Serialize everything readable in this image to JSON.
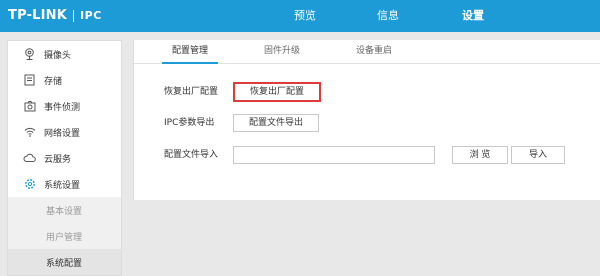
{
  "header": {
    "logo": "TP-LINK",
    "product": "IPC",
    "nav": [
      "预览",
      "信息",
      "设置"
    ],
    "active_nav": "设置",
    "color": "#1c9bd6"
  },
  "sidebar": {
    "items": [
      {
        "label": "摄像头",
        "icon": "camera-icon"
      },
      {
        "label": "存储",
        "icon": "storage-icon"
      },
      {
        "label": "事件侦测",
        "icon": "event-detect-icon"
      },
      {
        "label": "网络设置",
        "icon": "wifi-icon"
      },
      {
        "label": "云服务",
        "icon": "cloud-icon"
      },
      {
        "label": "系统设置",
        "icon": "gear-icon"
      }
    ],
    "sub_items": [
      "基本设置",
      "用户管理",
      "系统配置"
    ],
    "current_sub": "系统配置"
  },
  "tabs": [
    "配置管理",
    "固件升级",
    "设备重启"
  ],
  "active_tab": "配置管理",
  "form": {
    "restore_label": "恢复出厂配置",
    "restore_button": "恢复出厂配置",
    "export_label": "IPC参数导出",
    "export_button": "配置文件导出",
    "import_label": "配置文件导入",
    "import_value": "",
    "browse_button": "浏 览",
    "import_button": "导入"
  }
}
